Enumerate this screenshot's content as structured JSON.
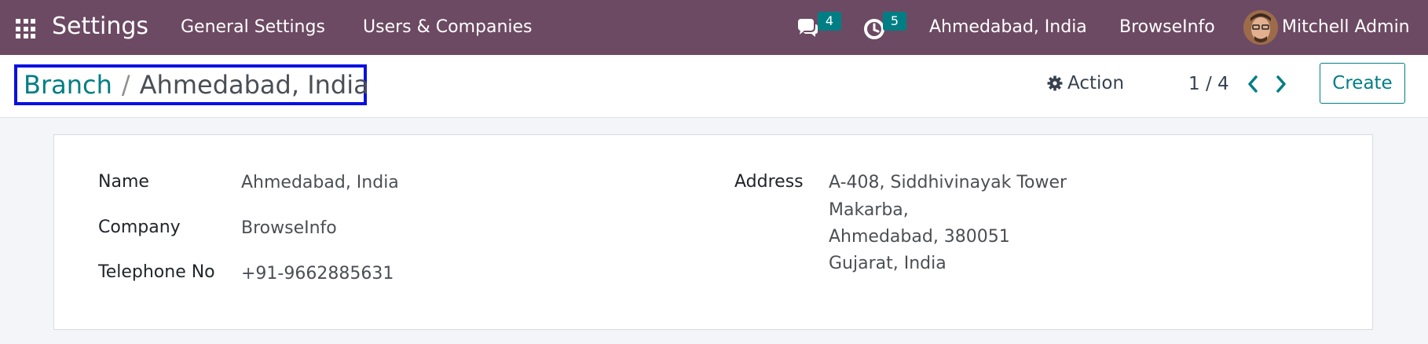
{
  "navbar": {
    "app_title": "Settings",
    "menu": [
      "General Settings",
      "Users & Companies"
    ],
    "messages_count": "4",
    "activities_count": "5",
    "current_branch": "Ahmedabad, India",
    "current_company": "BrowseInfo",
    "user_name": "Mitchell Admin",
    "icons": {
      "apps": "grid-icon",
      "messages": "chat-icon",
      "activities": "clock-icon"
    },
    "colors": {
      "bar": "#6c4a63",
      "badge": "#017e84"
    }
  },
  "control_panel": {
    "breadcrumb_parent": "Branch",
    "breadcrumb_separator": "/",
    "breadcrumb_current": "Ahmedabad, India",
    "action_label": "Action",
    "pager": "1 / 4",
    "create_label": "Create",
    "colors": {
      "link": "#017e84",
      "highlight_box": "#0a10e0"
    }
  },
  "form": {
    "name_label": "Name",
    "name_value": "Ahmedabad, India",
    "company_label": "Company",
    "company_value": "BrowseInfo",
    "phone_label": "Telephone No",
    "phone_value": "+91-9662885631",
    "address_label": "Address",
    "address_lines": [
      "A-408, Siddhivinayak Tower",
      "Makarba,",
      "Ahmedabad, 380051",
      "Gujarat, India"
    ]
  }
}
